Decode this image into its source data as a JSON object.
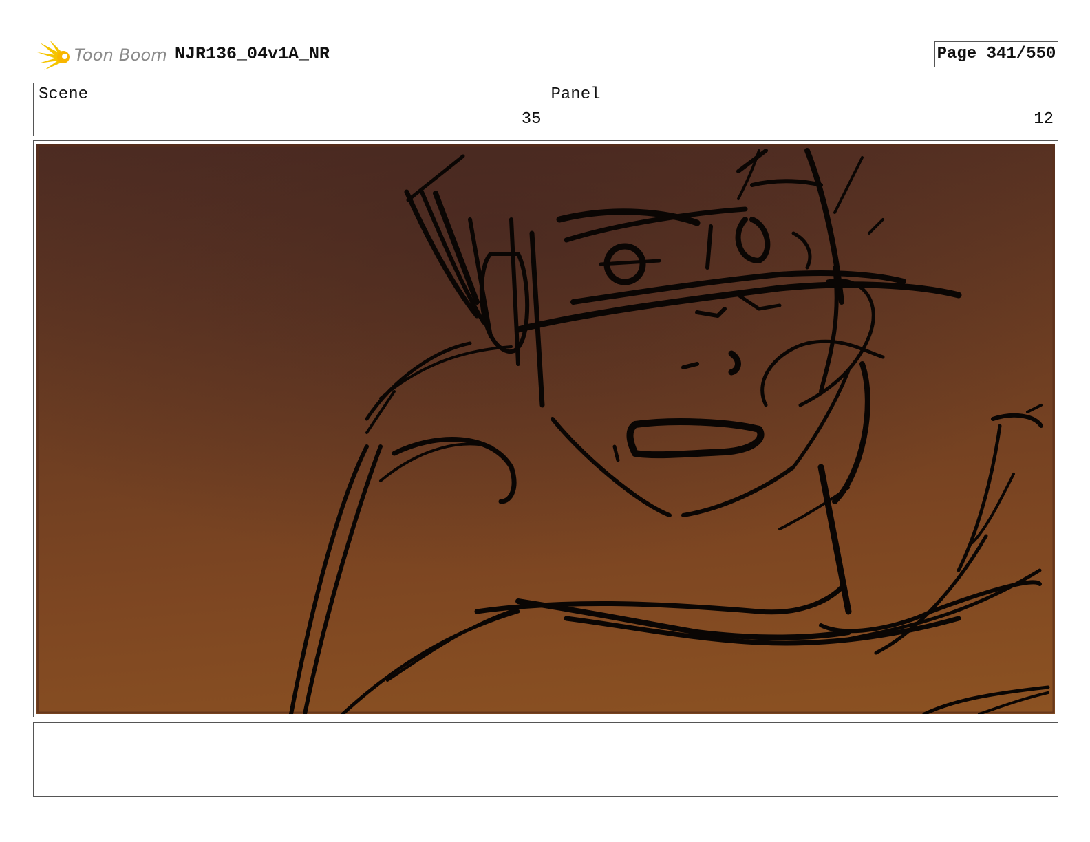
{
  "header": {
    "logo_text": "Toon Boom",
    "project_title": "NJR136_04v1A_NR",
    "page_label": "Page 341/550"
  },
  "info": {
    "scene_label": "Scene",
    "scene_value": "35",
    "panel_label": "Panel",
    "panel_value": "12"
  },
  "panel": {
    "image_description": "rough storyboard sketch of a startled character wearing a headband, black ink lines on an orange-brown gradient background",
    "background_colors": [
      "#4e2c22",
      "#673a22",
      "#7d4622",
      "#8c5222"
    ],
    "line_color": "#0a0604"
  },
  "notes": {
    "text": ""
  }
}
